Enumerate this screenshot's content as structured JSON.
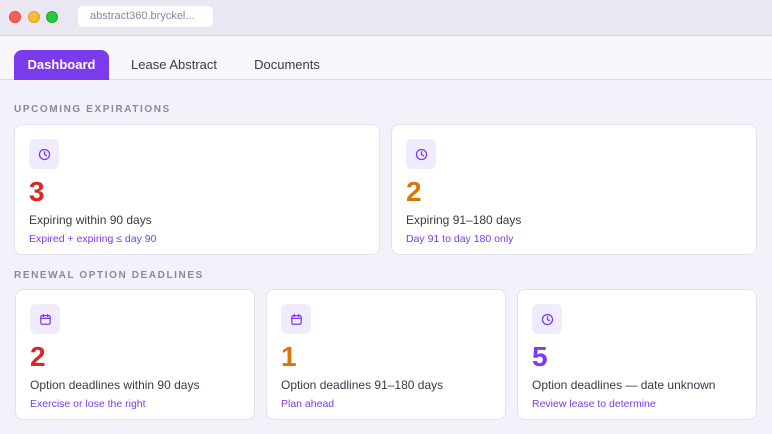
{
  "window": {
    "url": "abstract360.bryckel..."
  },
  "tabs": [
    {
      "label": "Dashboard"
    },
    {
      "label": "Lease Abstract"
    },
    {
      "label": "Documents"
    }
  ],
  "sections": {
    "expirations": {
      "title": "UPCOMING EXPIRATIONS",
      "cards": [
        {
          "icon": "clock-icon",
          "value": "3",
          "value_color": "#dc2626",
          "label": "Expiring within 90 days",
          "note": "Expired + expiring ≤ day 90"
        },
        {
          "icon": "clock-icon",
          "value": "2",
          "value_color": "#d97706",
          "label": "Expiring 91–180 days",
          "note": "Day 91 to day 180 only"
        }
      ]
    },
    "renewals": {
      "title": "RENEWAL OPTION DEADLINES",
      "cards": [
        {
          "icon": "calendar-icon",
          "value": "2",
          "value_color": "#dc2626",
          "label": "Option deadlines within 90 days",
          "note": "Exercise or lose the right"
        },
        {
          "icon": "calendar-icon",
          "value": "1",
          "value_color": "#d97706",
          "label": "Option deadlines 91–180 days",
          "note": "Plan ahead"
        },
        {
          "icon": "clock-icon",
          "value": "5",
          "value_color": "#7c3aed",
          "label": "Option deadlines — date unknown",
          "note": "Review lease to determine"
        }
      ]
    }
  },
  "colors": {
    "accent": "#7c3aed"
  }
}
